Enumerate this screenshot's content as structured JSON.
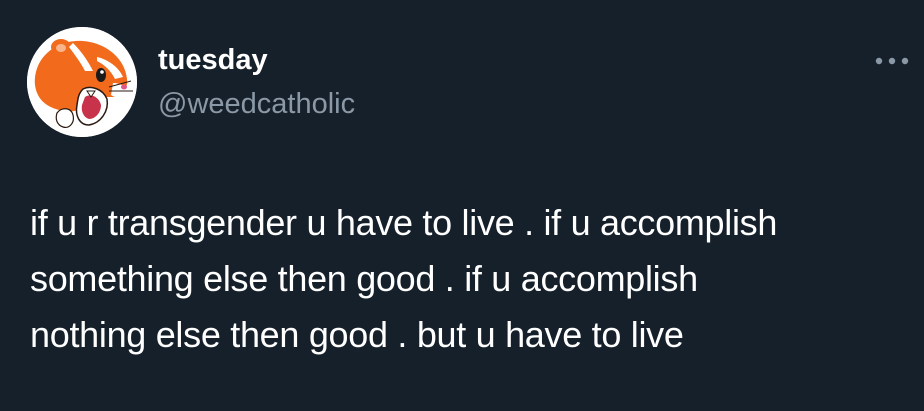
{
  "author": {
    "display_name": "tuesday",
    "handle": "@weedcatholic",
    "avatar_icon": "hamster-avatar-icon"
  },
  "actions": {
    "more_icon": "more-options-icon"
  },
  "tweet": {
    "text": "if u r transgender u have to live . if u accomplish\nsomething else then good .  if u accomplish\nnothing else then good . but u have to live"
  },
  "colors": {
    "background": "#15202b",
    "text": "#ffffff",
    "secondary_text": "#8b98a5",
    "avatar_orange": "#f26a1b"
  }
}
